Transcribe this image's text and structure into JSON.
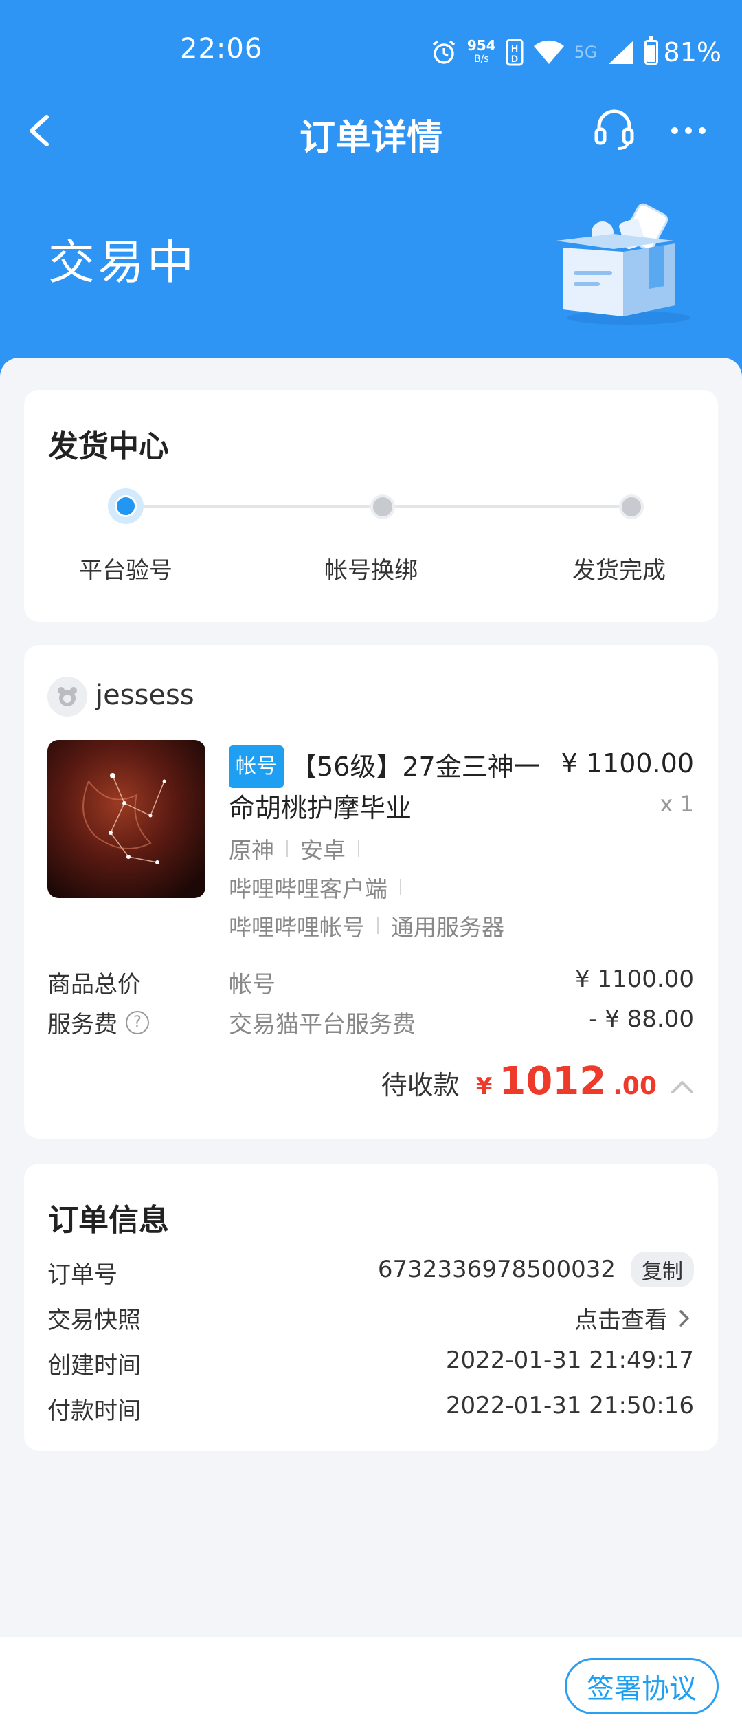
{
  "status_bar": {
    "time": "22:06",
    "net_speed": "954",
    "net_unit": "B/s",
    "network_5g": "5G",
    "battery": "81%"
  },
  "nav": {
    "title": "订单详情"
  },
  "order_status": "交易中",
  "delivery": {
    "title": "发货中心",
    "steps": [
      "平台验号",
      "帐号换绑",
      "发货完成"
    ],
    "active_step": 0
  },
  "order": {
    "seller": "jessess",
    "tag": "帐号",
    "product_title": "【56级】27金三神一命胡桃护摩毕业",
    "price": "¥ 1100.00",
    "qty": "x 1",
    "attrs_row1": [
      "原神",
      "安卓"
    ],
    "attrs_row2": [
      "哔哩哔哩客户端"
    ],
    "attrs_row3": [
      "哔哩哔哩帐号",
      "通用服务器"
    ],
    "total_label": "商品总价",
    "total_desc": "帐号",
    "total_value": "¥ 1100.00",
    "fee_label": "服务费",
    "fee_desc": "交易猫平台服务费",
    "fee_value": "- ¥ 88.00",
    "pending_label": "待收款",
    "pending_yen": "¥",
    "pending_int": "1012",
    "pending_dec": ".00"
  },
  "info": {
    "title": "订单信息",
    "order_no_label": "订单号",
    "order_no": "6732336978500032",
    "copy_label": "复制",
    "snapshot_label": "交易快照",
    "snapshot_value": "点击查看",
    "created_label": "创建时间",
    "created_value": "2022-01-31 21:49:17",
    "paid_label": "付款时间",
    "paid_value": "2022-01-31 21:50:16"
  },
  "bottom": {
    "sign_label": "签署协议"
  },
  "colors": {
    "primary": "#2e95f4",
    "accent_red": "#ee3a2a",
    "tag_blue": "#1e9ff2"
  }
}
